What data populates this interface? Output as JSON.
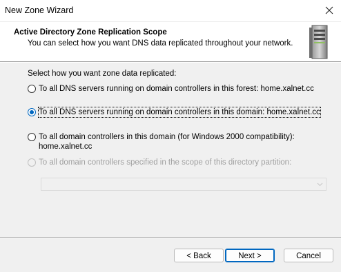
{
  "window": {
    "title": "New Zone Wizard"
  },
  "header": {
    "title": "Active Directory Zone Replication Scope",
    "subtitle": "You can select how you want DNS data replicated throughout your network."
  },
  "form": {
    "prompt": "Select how you want zone data replicated:",
    "options": [
      {
        "label": "To all DNS servers running on domain controllers in this forest: home.xalnet.cc",
        "selected": false,
        "enabled": true
      },
      {
        "label": "To all DNS servers running on domain controllers in this domain: home.xalnet.cc",
        "selected": true,
        "enabled": true
      },
      {
        "label_line1": "To all domain controllers in this domain (for Windows 2000 compatibility):",
        "label_line2": "home.xalnet.cc",
        "selected": false,
        "enabled": true
      },
      {
        "label": "To all domain controllers specified in the scope of this directory partition:",
        "selected": false,
        "enabled": false
      }
    ],
    "partition_select": {
      "value": "",
      "enabled": false
    }
  },
  "buttons": {
    "back": "< Back",
    "next": "Next >",
    "cancel": "Cancel"
  },
  "colors": {
    "accent": "#0067c0",
    "disabled_text": "#a0a0a0"
  },
  "icons": [
    "close-icon",
    "server-icon",
    "chevron-down-icon"
  ]
}
